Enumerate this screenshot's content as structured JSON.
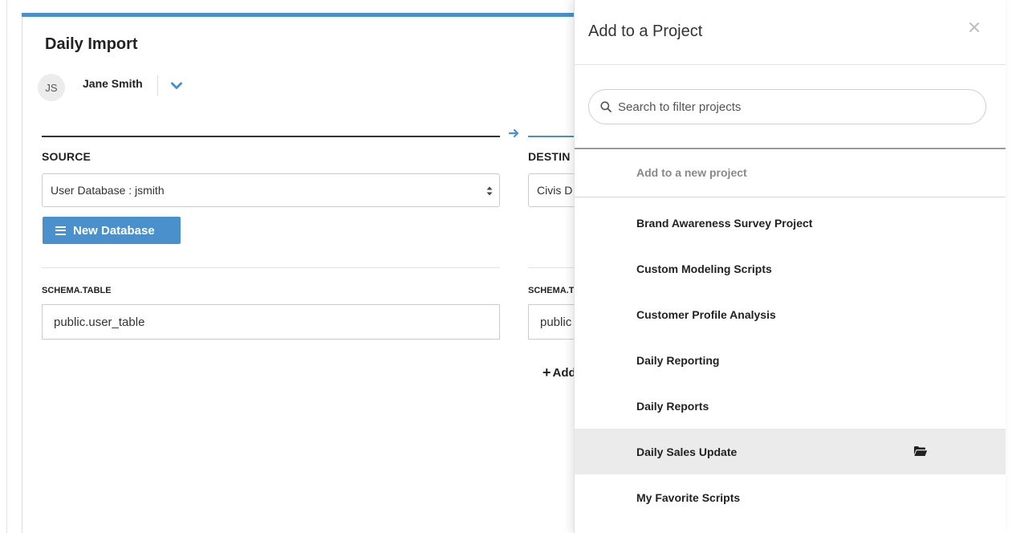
{
  "job": {
    "title": "Daily Import",
    "owner": {
      "initials": "JS",
      "name": "Jane Smith"
    }
  },
  "source": {
    "heading": "SOURCE",
    "database_selected": "User Database : jsmith",
    "new_database_label": "New Database",
    "schema_label": "SCHEMA.TABLE",
    "schema_value": "public.user_table"
  },
  "destination": {
    "heading": "DESTIN",
    "database_selected": "Civis D",
    "schema_label": "SCHEMA.T",
    "schema_value": "public",
    "add_label": "Add"
  },
  "panel": {
    "title": "Add to a Project",
    "search_placeholder": "Search to filter projects",
    "new_project_label": "Add to a new project",
    "projects": [
      {
        "label": "Brand Awareness Survey Project"
      },
      {
        "label": "Custom Modeling Scripts"
      },
      {
        "label": "Customer Profile Analysis"
      },
      {
        "label": "Daily Reporting"
      },
      {
        "label": "Daily Reports"
      },
      {
        "label": "Daily Sales Update"
      },
      {
        "label": "My Favorite Scripts"
      }
    ],
    "selected_project": "Daily Sales Update"
  },
  "colors": {
    "accent": "#4a90cd",
    "selected_row": "#ebebeb"
  },
  "icons": [
    "chevron-down-icon",
    "arrow-right-icon",
    "select-arrows-icon",
    "hamburger-icon",
    "plus-icon",
    "close-icon",
    "search-icon",
    "folder-open-icon"
  ]
}
